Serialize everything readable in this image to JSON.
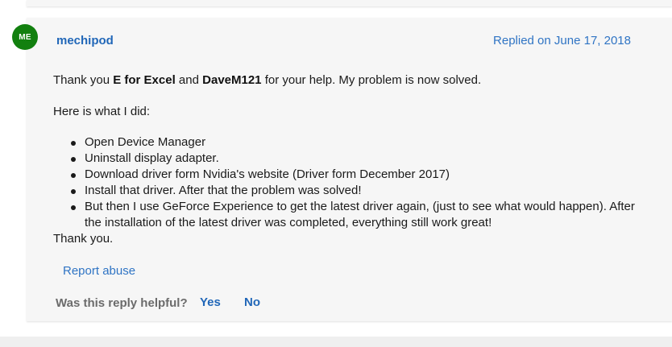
{
  "reply": {
    "avatar_initials": "ME",
    "avatar_color": "#12800f",
    "username": "mechipod",
    "replied_date": "Replied on June 17, 2018",
    "intro": {
      "prefix": "Thank you ",
      "name1": "E for Excel",
      "middle": " and ",
      "name2": "DaveM121",
      "suffix": " for your help. My problem is now solved."
    },
    "lead": "Here is what I did:",
    "steps": [
      "Open Device Manager",
      "Uninstall display adapter.",
      "Download driver form Nvidia's website (Driver form December 2017)",
      "Install that driver. After that the problem was solved!",
      "But then I use GeForce Experience to get the latest driver again, (just to see what would happen). After the installation of the latest driver was completed, everything still work great!"
    ],
    "closing": "Thank you.",
    "report_abuse": "Report abuse",
    "helpful_question": "Was this reply helpful?",
    "yes_label": "Yes",
    "no_label": "No"
  },
  "colors": {
    "link": "#2167b8",
    "card_bg": "#f6f6f6"
  }
}
